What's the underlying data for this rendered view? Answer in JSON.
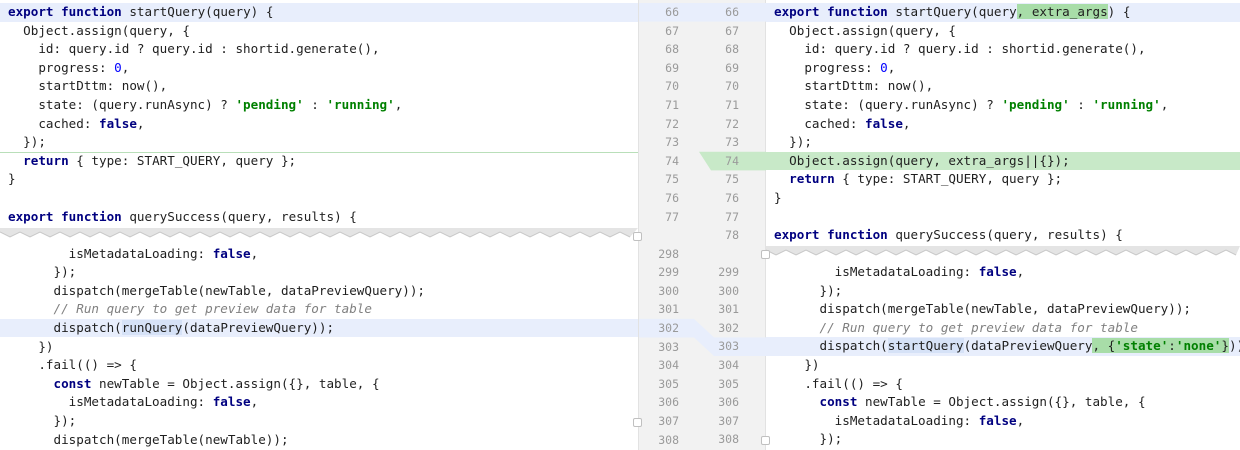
{
  "left": {
    "top": [
      {
        "n": "66",
        "t": "export function startQuery(query) {"
      },
      {
        "n": "67",
        "t": "  Object.assign(query, {"
      },
      {
        "n": "68",
        "t": "    id: query.id ? query.id : shortid.generate(),"
      },
      {
        "n": "69",
        "t": "    progress: 0,"
      },
      {
        "n": "70",
        "t": "    startDttm: now(),"
      },
      {
        "n": "71",
        "t": "    state: (query.runAsync) ? 'pending' : 'running',"
      },
      {
        "n": "72",
        "t": "    cached: false,"
      },
      {
        "n": "73",
        "t": "  });"
      },
      {
        "n": "74",
        "t": "  return { type: START_QUERY, query };"
      },
      {
        "n": "75",
        "t": "}"
      },
      {
        "n": "76",
        "t": ""
      },
      {
        "n": "77",
        "t": "export function querySuccess(query, results) {"
      }
    ],
    "bottom": [
      {
        "n": "298",
        "t": "        isMetadataLoading: false,"
      },
      {
        "n": "299",
        "t": "      });"
      },
      {
        "n": "300",
        "t": "      dispatch(mergeTable(newTable, dataPreviewQuery));"
      },
      {
        "n": "301",
        "t": "      // Run query to get preview data for table"
      },
      {
        "n": "302",
        "t": "      dispatch(runQuery(dataPreviewQuery));"
      },
      {
        "n": "303",
        "t": "    })"
      },
      {
        "n": "304",
        "t": "    .fail(() => {"
      },
      {
        "n": "305",
        "t": "      const newTable = Object.assign({}, table, {"
      },
      {
        "n": "306",
        "t": "        isMetadataLoading: false,"
      },
      {
        "n": "307",
        "t": "      });"
      },
      {
        "n": "308",
        "t": "      dispatch(mergeTable(newTable));"
      }
    ]
  },
  "right": {
    "top": [
      {
        "n": "66",
        "t": "export function startQuery(query, extra_args) {"
      },
      {
        "n": "67",
        "t": "  Object.assign(query, {"
      },
      {
        "n": "68",
        "t": "    id: query.id ? query.id : shortid.generate(),"
      },
      {
        "n": "69",
        "t": "    progress: 0,"
      },
      {
        "n": "70",
        "t": "    startDttm: now(),"
      },
      {
        "n": "71",
        "t": "    state: (query.runAsync) ? 'pending' : 'running',"
      },
      {
        "n": "72",
        "t": "    cached: false,"
      },
      {
        "n": "73",
        "t": "  });"
      },
      {
        "n": "74",
        "t": "  Object.assign(query, extra_args||{});"
      },
      {
        "n": "75",
        "t": "  return { type: START_QUERY, query };"
      },
      {
        "n": "76",
        "t": "}"
      },
      {
        "n": "77",
        "t": ""
      },
      {
        "n": "78",
        "t": "export function querySuccess(query, results) {"
      }
    ],
    "bottom": [
      {
        "n": "299",
        "t": "        isMetadataLoading: false,"
      },
      {
        "n": "300",
        "t": "      });"
      },
      {
        "n": "301",
        "t": "      dispatch(mergeTable(newTable, dataPreviewQuery));"
      },
      {
        "n": "302",
        "t": "      // Run query to get preview data for table"
      },
      {
        "n": "303",
        "t": "      dispatch(startQuery(dataPreviewQuery, {'state':'none'}));"
      },
      {
        "n": "304",
        "t": "    })"
      },
      {
        "n": "305",
        "t": "    .fail(() => {"
      },
      {
        "n": "306",
        "t": "      const newTable = Object.assign({}, table, {"
      },
      {
        "n": "307",
        "t": "        isMetadataLoading: false,"
      },
      {
        "n": "308",
        "t": "      });"
      }
    ]
  },
  "colors": {
    "changed_line": "#e8eefc",
    "added_line": "#c8e9c8",
    "gutter": "#f2f2f2",
    "keyword": "#000080",
    "string": "#008000",
    "number": "#0000ff",
    "comment": "#808080"
  },
  "icons": [
    "fold-marker-icon"
  ]
}
